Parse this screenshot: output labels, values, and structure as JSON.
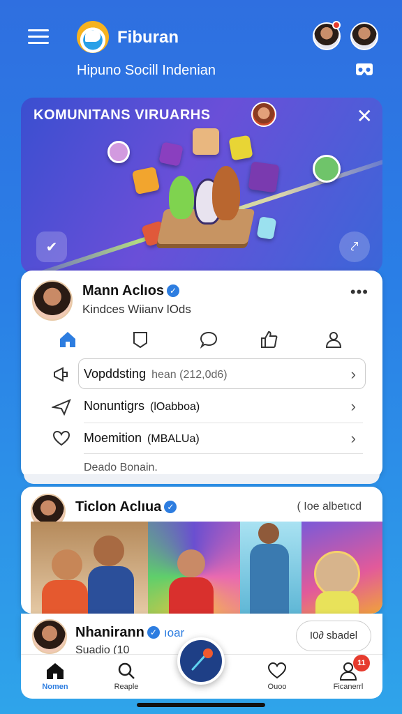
{
  "header": {
    "app_name": "Fiburan",
    "subtitle": "Hipuno Socill Indenian"
  },
  "banner": {
    "title": "KOMUNITANS VIRUARHS",
    "close_label": "✕"
  },
  "post1": {
    "name": "Mann Aclıos",
    "handle": "Kindces Wiianv lOds",
    "more": "•••",
    "menu": [
      {
        "label": "Vopddsting",
        "sub": "hean (212,0d6)"
      },
      {
        "label": "Nonuntigrs",
        "sub": "(lOabboa)"
      },
      {
        "label": "Moemition",
        "sub": "(MBALUa)"
      }
    ],
    "footer": "Deado Bonain."
  },
  "post2": {
    "name": "Ticlon Aclıua",
    "meta": "( Ioe albetıcd"
  },
  "post3": {
    "name": "Nhanirann",
    "label": "ıoar",
    "sub": "Suadio (10",
    "chip": "I0∂ sbadel"
  },
  "bottom_nav": {
    "items": [
      {
        "label": "Nomen",
        "icon": "home-icon"
      },
      {
        "label": "Reaple",
        "icon": "search-icon"
      },
      {
        "label": "Ouoo",
        "icon": "heart-icon"
      },
      {
        "label": "Ficanerrl",
        "icon": "profile-icon"
      }
    ],
    "notification_count": "11"
  },
  "colors": {
    "background_top": "#2f6fe0",
    "background_bottom": "#2fa4ea",
    "accent": "#2d7de0",
    "badge": "#e63b2e",
    "fab": "#1e3f86"
  }
}
